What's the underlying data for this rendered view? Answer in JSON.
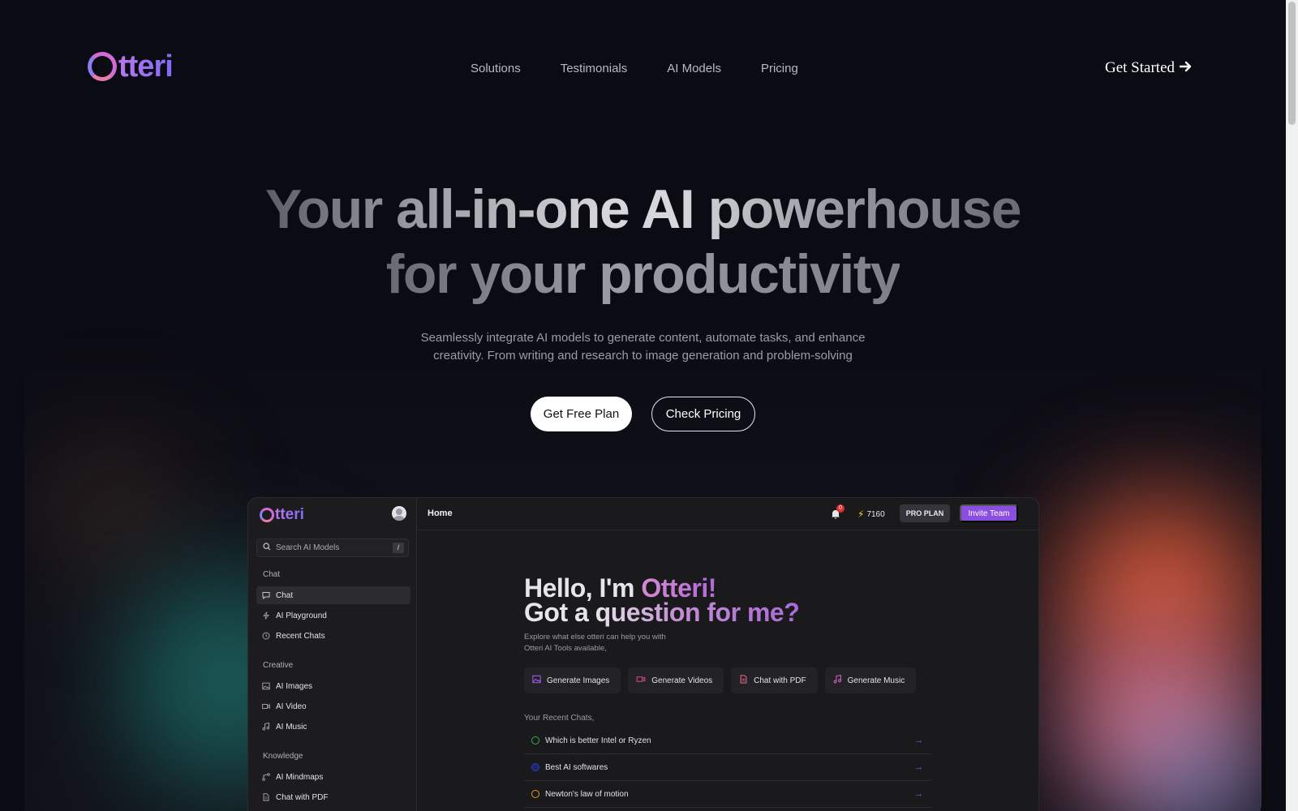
{
  "colors": {
    "background": "#0b0b13",
    "accent_purple": "#8a4fe0",
    "logo_gradient_start": "#b977ee",
    "logo_gradient_end": "#7e6cf5",
    "glow_orange": "#e8643c",
    "glow_teal": "#1f6b66"
  },
  "brand": {
    "logo_text": "tteri"
  },
  "nav": {
    "items": [
      {
        "label": "Solutions"
      },
      {
        "label": "Testimonials"
      },
      {
        "label": "AI Models"
      },
      {
        "label": "Pricing"
      }
    ],
    "cta_label": "Get Started",
    "cta_icon": "arrow-right-icon"
  },
  "hero": {
    "title_line1": "Your all-in-one AI powerhouse",
    "title_line2": "for your productivity",
    "subtitle_line1": "Seamlessly integrate AI models to generate content, automate tasks, and enhance",
    "subtitle_line2": "creativity. From writing and research to image generation and problem-solving",
    "primary_button": "Get Free Plan",
    "secondary_button": "Check Pricing"
  },
  "app": {
    "logo_text": "tteri",
    "search_placeholder": "Search AI Models",
    "search_shortcut": "/",
    "sections": [
      {
        "title": "Chat",
        "items": [
          {
            "label": "Chat",
            "icon": "message-icon",
            "active": true
          },
          {
            "label": "AI Playground",
            "icon": "sparkle-icon"
          },
          {
            "label": "Recent Chats",
            "icon": "clock-icon"
          }
        ]
      },
      {
        "title": "Creative",
        "items": [
          {
            "label": "AI Images",
            "icon": "image-icon"
          },
          {
            "label": "AI Video",
            "icon": "video-icon"
          },
          {
            "label": "AI Music",
            "icon": "music-icon"
          }
        ]
      },
      {
        "title": "Knowledge",
        "items": [
          {
            "label": "AI Mindmaps",
            "icon": "mindmap-icon"
          },
          {
            "label": "Chat with PDF",
            "icon": "document-icon"
          }
        ]
      }
    ],
    "topbar": {
      "breadcrumb": "Home",
      "notification_count": "0",
      "credits": "7160",
      "plan_badge": "PRO PLAN",
      "invite_button": "Invite Team"
    },
    "greeting": {
      "line1_prefix": "Hello, I'm ",
      "line1_accent": "Otteri!",
      "line2_prefix": "Got a ",
      "line2_accent": "question for me?",
      "explore_line1": "Explore what else otteri can help you with",
      "explore_line2": "Otteri AI Tools available,"
    },
    "tools": [
      {
        "label": "Generate Images",
        "icon": "image-icon",
        "color": "#9b5de5"
      },
      {
        "label": "Generate Videos",
        "icon": "video-icon",
        "color": "#d0458e"
      },
      {
        "label": "Chat with PDF",
        "icon": "document-icon",
        "color": "#e06c8c"
      },
      {
        "label": "Generate Music",
        "icon": "music-icon",
        "color": "#c65fb8"
      }
    ],
    "recent_label": "Your Recent Chats,",
    "recent_chats": [
      {
        "title": "Which is better Intel or Ryzen",
        "dot_color": "#2fb34a"
      },
      {
        "title": "Best AI softwares",
        "dot_color": "#2c3fb0"
      },
      {
        "title": "Newton's law of motion",
        "dot_color": "#e09b2a"
      }
    ]
  }
}
